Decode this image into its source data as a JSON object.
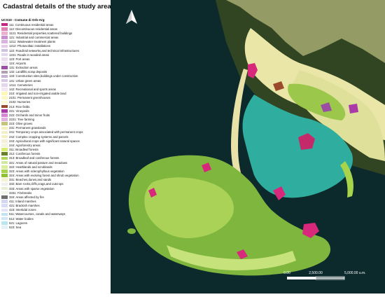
{
  "title": "Cadastral details of the study area.",
  "legend": {
    "title": "UCS10 - Comune di Orb-Arg",
    "items": [
      {
        "label": "111: Continuous residential areas",
        "color": "#c5267f"
      },
      {
        "label": "112: Discontinuous residential areas",
        "color": "#e07fb4"
      },
      {
        "label": "1121: Residential properties,scattered buildings",
        "color": "#ebb0cf"
      },
      {
        "label": "121: Industrial and commercial areas",
        "color": "#c98ecf"
      },
      {
        "label": "1211: Wastewater treatment plants",
        "color": "#d9b2df"
      },
      {
        "label": "1212: Photovoltaic installations",
        "color": "#e5cce9"
      },
      {
        "label": "122: Road/rail networks,and technical infrastructures",
        "color": "#cfc2e0"
      },
      {
        "label": "1221: Roads in wooded areas",
        "color": "#e2d8ee"
      },
      {
        "label": "123: Port areas",
        "color": "#ecdcef"
      },
      {
        "label": "124: Airports",
        "color": "#efe7f2"
      },
      {
        "label": "131: Extraction areas",
        "color": "#9a4fa5"
      },
      {
        "label": "132: Landfills,scrap deposits",
        "color": "#b1a0b2"
      },
      {
        "label": "133: Construction sites,buildings under construction",
        "color": "#c7b1d4"
      },
      {
        "label": "141: Urban green areas",
        "color": "#d7c6e4"
      },
      {
        "label": "1411: Cemeteries",
        "color": "#e4d7ed"
      },
      {
        "label": "142: Recreational and sports areas",
        "color": "#f2e8f4"
      },
      {
        "label": "210: Irrigated and non-irrigated arable land",
        "color": "#fbf8b8"
      },
      {
        "label": "2101: Permanent greenhouses",
        "color": "#fbf8c6"
      },
      {
        "label": "2102: Nurseries",
        "color": "#fcfad3"
      },
      {
        "label": "213: Rice fields",
        "color": "#9c4a2c"
      },
      {
        "label": "221: Vineyards",
        "color": "#a93aa8"
      },
      {
        "label": "222: Orchards and minor fruits",
        "color": "#d788d3"
      },
      {
        "label": "2221: Tree farming",
        "color": "#e3b0e0"
      },
      {
        "label": "223: Olive groves",
        "color": "#c4c47d"
      },
      {
        "label": "231: Permanent grasslands",
        "color": "#f2f1bf"
      },
      {
        "label": "241: Temporary crops associated with permanent crops",
        "color": "#f1efc9"
      },
      {
        "label": "242: Complex cropping systems and parcels",
        "color": "#f5efc4"
      },
      {
        "label": "243: Agricultural crops with significant natural spaces",
        "color": "#f5f0d5"
      },
      {
        "label": "244: Agroforestry areas",
        "color": "#f8f5df"
      },
      {
        "label": "311: Broadleaf forests",
        "color": "#d7ee72"
      },
      {
        "label": "312: Coniferous forests",
        "color": "#6a7f2a"
      },
      {
        "label": "313: Broadleaf and coniferous forests",
        "color": "#b0d55a"
      },
      {
        "label": "321: Areas of natural pasture and meadows",
        "color": "#cfe9a2"
      },
      {
        "label": "322: Heathlands and scrublands",
        "color": "#d9ef9e"
      },
      {
        "label": "323: Areas with sclerophyllous vegetation",
        "color": "#a8d44b"
      },
      {
        "label": "324: Areas with evolving forest and shrub vegetation",
        "color": "#8fc233"
      },
      {
        "label": "331: Beaches,dunes,and sands",
        "color": "#f4f2cf"
      },
      {
        "label": "332: Bare rocks,cliffs,crags,and outcrops",
        "color": "#efefec"
      },
      {
        "label": "333: Areas with sparse vegetation",
        "color": "#e4efd4"
      },
      {
        "label": "3331: Firebreaks",
        "color": "#f0f6ea"
      },
      {
        "label": "334: Areas affected by fire",
        "color": "#6f6f6f"
      },
      {
        "label": "411: Inland marshes",
        "color": "#d3d5f1"
      },
      {
        "label": "421: Brackish marshes",
        "color": "#dadcf5"
      },
      {
        "label": "423: Intertidal zones",
        "color": "#e2e4f6"
      },
      {
        "label": "511: Watercourses, canals and waterways",
        "color": "#c3e2f2"
      },
      {
        "label": "512: Water bodies",
        "color": "#cfe8f6"
      },
      {
        "label": "521: Lagoons",
        "color": "#b9e6ef"
      },
      {
        "label": "523: Sea",
        "color": "#e5f1f8"
      }
    ]
  },
  "map": {
    "north_arrow_icon": "north-arrow-icon",
    "scale_bar": {
      "labels": [
        "0.00",
        "2,500.00",
        "5,000.00 u.m."
      ]
    },
    "colors": {
      "sea": "#0c2a2c",
      "lagoon": "#2fae9f",
      "land_dark": "#37451f",
      "crops": "#e9e6a4",
      "forest": "#7ab43a",
      "residential": "#d8287c"
    }
  }
}
